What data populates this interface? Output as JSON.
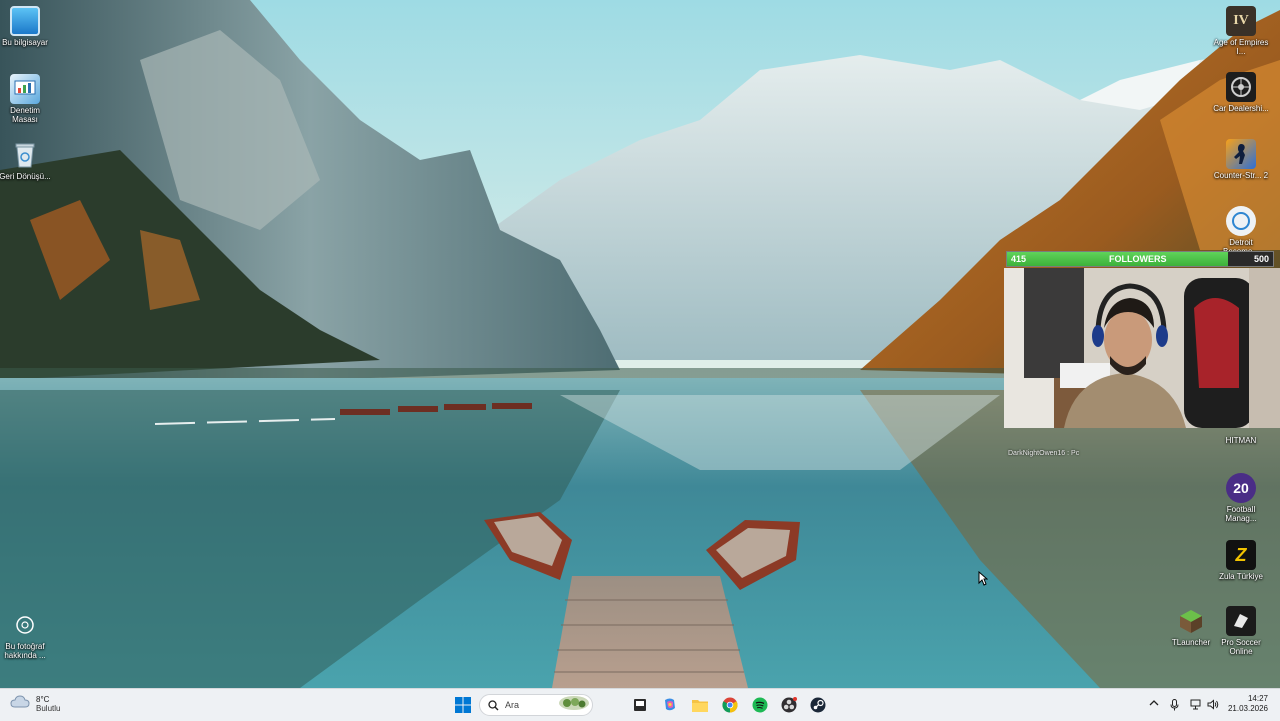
{
  "desktop": {
    "left_icons": [
      {
        "label": "Bu bilgisayar",
        "icon": "monitor-icon"
      },
      {
        "label": "Denetim Masası",
        "icon": "control-panel-icon"
      },
      {
        "label": "Geri Dönüşü...",
        "icon": "recycle-bin-icon"
      }
    ],
    "photo_info": {
      "label": "Bu fotoğraf hakkında ...",
      "icon": "camera-info-icon"
    },
    "right_icons": [
      {
        "label": "Age of Empires I...",
        "glyph": "IV",
        "icon": "age-of-empires-icon"
      },
      {
        "label": "Car Dealershi...",
        "glyph": "",
        "icon": "car-dealership-icon"
      },
      {
        "label": "Counter-Str... 2",
        "glyph": "",
        "icon": "counter-strike-icon"
      },
      {
        "label": "Detroit Become...",
        "glyph": "",
        "icon": "detroit-icon"
      },
      {
        "label": "HITMAN",
        "glyph": "",
        "icon": "hitman-icon"
      },
      {
        "label": "Football Manag...",
        "glyph": "20",
        "icon": "football-manager-icon"
      },
      {
        "label": "Zula Türkiye",
        "glyph": "Z",
        "icon": "zula-icon"
      },
      {
        "label": "TLauncher",
        "glyph": "",
        "icon": "tlauncher-icon"
      },
      {
        "label": "Pro Soccer Online",
        "glyph": "",
        "icon": "pro-soccer-icon"
      }
    ]
  },
  "overlay": {
    "followers_current": "415",
    "followers_label": "FOLLOWERS",
    "followers_goal": "500",
    "followers_progress": 0.83,
    "cam_caption": "DarkNightOwen16 : Pc"
  },
  "taskbar": {
    "weather_temp": "8°C",
    "weather_desc": "Bulutlu",
    "search_placeholder": "Ara",
    "pinned": [
      "start-icon",
      "search-icon",
      "widgets-icon",
      "task-view-icon",
      "copilot-icon",
      "file-explorer-icon",
      "chrome-icon",
      "spotify-icon",
      "obs-icon",
      "steam-icon"
    ],
    "time": "14:27",
    "date": "21.03.2026"
  },
  "colors": {
    "taskbar_bg": "#eef1f4",
    "followers_fill": "#4cc447",
    "windows_blue": "#0078d4"
  }
}
